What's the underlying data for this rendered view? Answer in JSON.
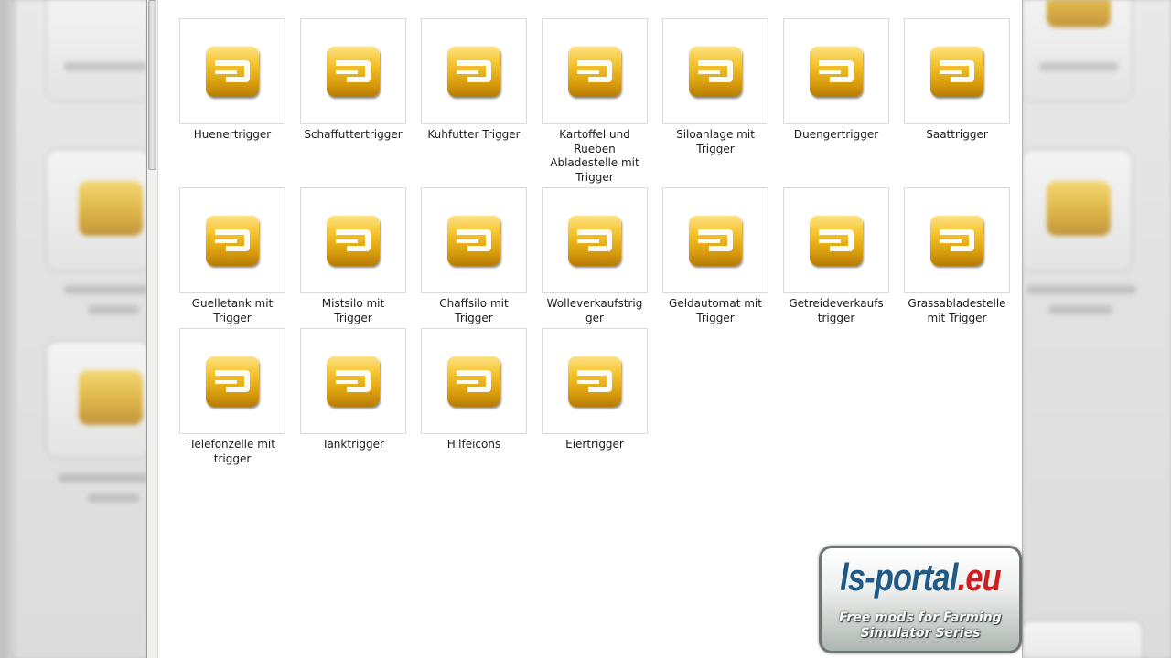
{
  "files": [
    {
      "name": "Huenertrigger",
      "icon": "file-icon"
    },
    {
      "name": "Schaffuttertrigger",
      "icon": "file-icon"
    },
    {
      "name": "Kuhfutter Trigger",
      "icon": "file-icon"
    },
    {
      "name": "Kartoffel und Rueben Abladestelle mit Trigger",
      "icon": "file-icon"
    },
    {
      "name": "Siloanlage mit Trigger",
      "icon": "file-icon"
    },
    {
      "name": "Duengertrigger",
      "icon": "file-icon"
    },
    {
      "name": "Saattrigger",
      "icon": "file-icon"
    },
    {
      "name": "Guelletank mit Trigger",
      "icon": "file-icon"
    },
    {
      "name": "Mistsilo mit Trigger",
      "icon": "file-icon"
    },
    {
      "name": "Chaffsilo mit Trigger",
      "icon": "file-icon"
    },
    {
      "name": "Wolleverkaufstrigger",
      "icon": "file-icon"
    },
    {
      "name": "Geldautomat mit Trigger",
      "icon": "file-icon"
    },
    {
      "name": "Getreideverkaufstrigger",
      "icon": "file-icon"
    },
    {
      "name": "Grassabladestelle mit Trigger",
      "icon": "file-icon"
    },
    {
      "name": "Telefonzelle mit trigger",
      "icon": "file-icon"
    },
    {
      "name": "Tanktrigger",
      "icon": "file-icon"
    },
    {
      "name": "Hilfeicons",
      "icon": "file-icon"
    },
    {
      "name": "Eiertrigger",
      "icon": "file-icon"
    }
  ],
  "watermark": {
    "logo_part1": "ls-portal",
    "logo_part2": ".eu",
    "tagline_line1": "Free mods for Farming",
    "tagline_line2": "Simulator Series"
  },
  "colors": {
    "icon_gold": "#f5c430",
    "logo_blue": "#1f5a86",
    "logo_red": "#d01e1e"
  }
}
